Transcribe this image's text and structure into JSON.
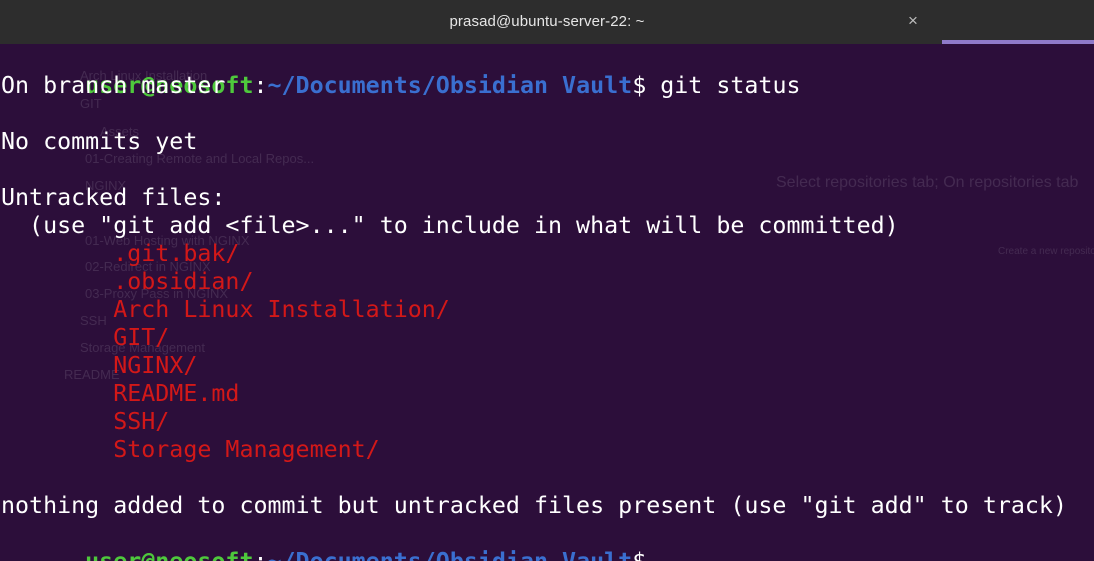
{
  "window": {
    "title": "prasad@ubuntu-server-22: ~",
    "close_glyph": "×"
  },
  "colors": {
    "background": "#2c0e3a",
    "titlebar": "#2d2d2d",
    "prompt_user": "#4ec83c",
    "prompt_path": "#3a6fd0",
    "untracked": "#d31818",
    "text": "#ffffff",
    "tab_indicator": "#8f7ac9"
  },
  "prompt": {
    "user_host": "user@neosoft",
    "separator": ":",
    "path": "~/Documents/Obsidian Vault",
    "symbol": "$"
  },
  "command": " git status",
  "output": {
    "branch": "On branch master",
    "no_commits": "No commits yet",
    "untracked_header": "Untracked files:",
    "hint": "  (use \"git add <file>...\" to include in what will be committed)",
    "untracked_files": [
      "        .git.bak/",
      "        .obsidian/",
      "        Arch Linux Installation/",
      "        GIT/",
      "        NGINX/",
      "        README.md",
      "        SSH/",
      "        Storage Management/"
    ],
    "summary": "nothing added to commit but untracked files present (use \"git add\" to track)"
  },
  "ghost": {
    "left_items": [
      "Arch Linux Installation",
      "GIT",
      "Assets",
      "01-Creating Remote and Local Repos...",
      "NGINX",
      "01-Web Hosting with NGINX",
      "02-Redirect in NGINX",
      "03-Proxy Pass in NGINX",
      "SSH",
      "Storage Management",
      "README"
    ],
    "right_heading": "Select repositories tab; On repositories tab",
    "right_subheading": "Create a new repository"
  }
}
